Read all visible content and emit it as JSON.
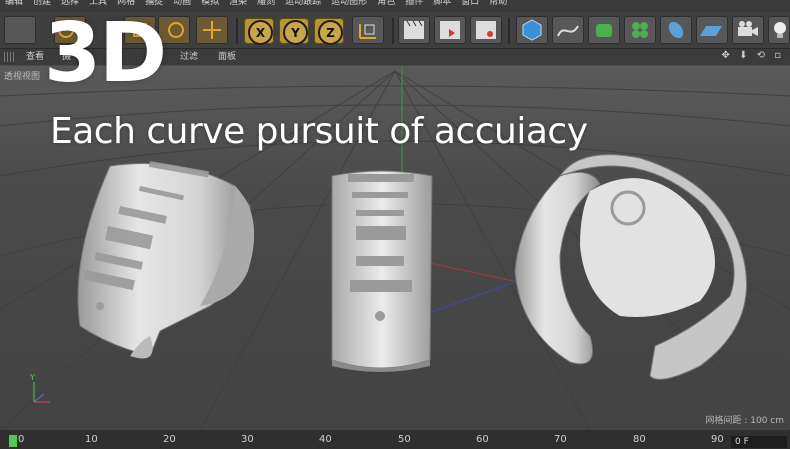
{
  "menu": {
    "items": [
      "编辑",
      "创建",
      "选择",
      "工具",
      "网格",
      "捕捉",
      "动画",
      "模拟",
      "渲染",
      "雕刻",
      "运动跟踪",
      "运动图形",
      "角色",
      "插件",
      "脚本",
      "窗口",
      "帮助"
    ]
  },
  "view_menu": {
    "items": [
      "查看",
      "摄",
      "显",
      "选",
      "过滤",
      "面板"
    ]
  },
  "toolbar": {
    "axis_x": "X",
    "axis_y": "Y",
    "axis_z": "Z"
  },
  "viewport": {
    "label": "透视视图",
    "grid_info": "网格间距 : 100 cm"
  },
  "overlay": {
    "title": "3D",
    "subtitle": "Each curve pursuit of accuiacy"
  },
  "timeline": {
    "ticks": [
      "0",
      "10",
      "20",
      "30",
      "40",
      "50",
      "60",
      "70",
      "80",
      "90"
    ],
    "frame": "0 F"
  },
  "colors": {
    "axis_button": "#b89434",
    "timeline_marker": "#58c558",
    "text_overlay": "#ffffff"
  }
}
